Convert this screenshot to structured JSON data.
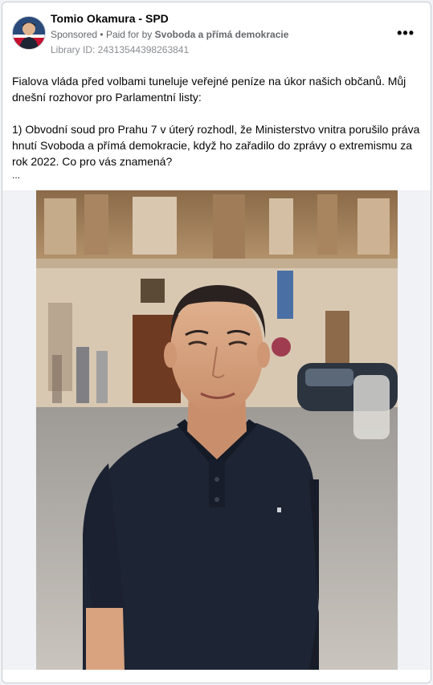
{
  "post": {
    "author": "Tomio Okamura - SPD",
    "sponsored": "Sponsored",
    "paid_prefix": "Paid for by",
    "paid_by": "Svoboda a přímá demokracie",
    "library_id": "Library ID: 24313544398263841",
    "more_icon": "more-horizontal-icon",
    "text_para1": "Fialova vláda před volbami tuneluje veřejné peníze na úkor našich občanů. Můj dnešní rozhovor pro Parlamentní listy:",
    "text_para2": "1) Obvodní soud pro Prahu 7 v úterý rozhodl, že Ministerstvo vnitra porušilo práva hnutí Svoboda a přímá demokracie, když ho zařadilo do zprávy o extremismu za rok 2022. Co pro vás znamená?",
    "ellipsis": "..."
  },
  "colors": {
    "shirt": "#1d2433",
    "building": "#c9a27a",
    "background": "#f0f2f5"
  }
}
